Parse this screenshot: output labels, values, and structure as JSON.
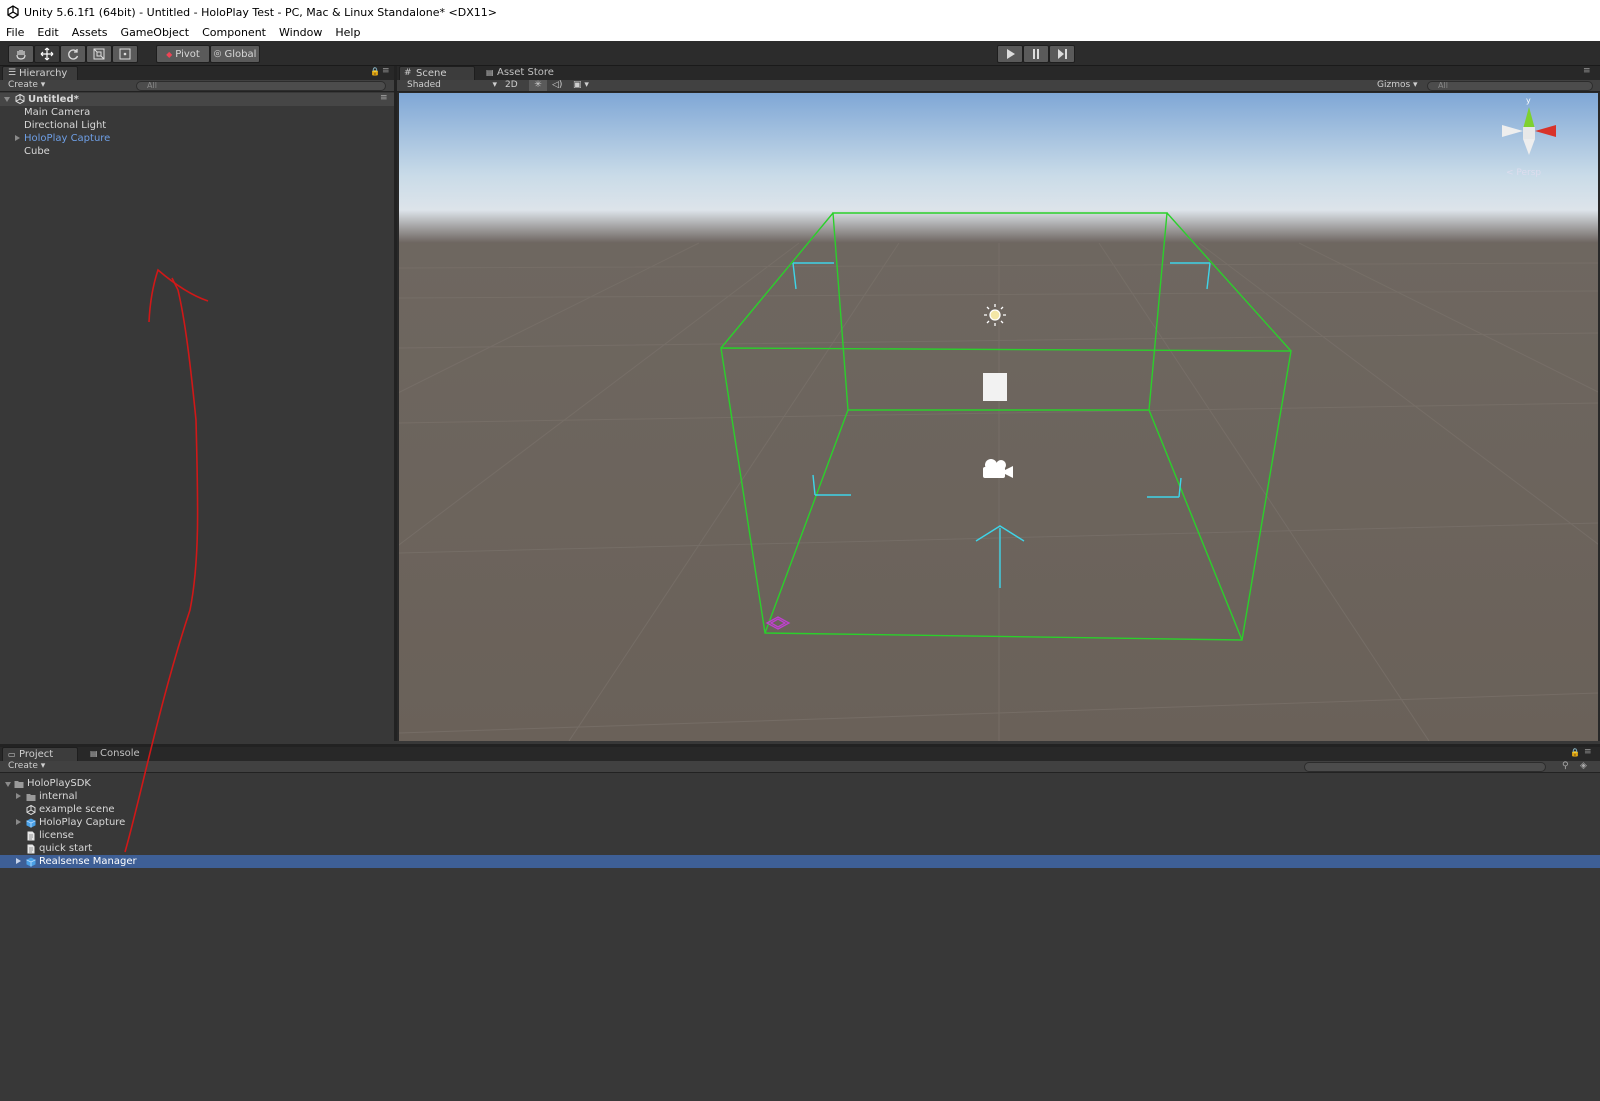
{
  "window": {
    "title": "Unity 5.6.1f1 (64bit) - Untitled - HoloPlay Test - PC, Mac & Linux Standalone* <DX11>"
  },
  "menu": [
    "File",
    "Edit",
    "Assets",
    "GameObject",
    "Component",
    "Window",
    "Help"
  ],
  "toolbar": {
    "pivot_label": "Pivot",
    "global_label": "Global"
  },
  "hierarchy": {
    "tab_label": "Hierarchy",
    "create_label": "Create",
    "search_placeholder": "All",
    "scene_name": "Untitled*",
    "items": [
      "Main Camera",
      "Directional Light",
      "HoloPlay Capture",
      "Cube"
    ]
  },
  "scene_view": {
    "tab_label": "Scene",
    "asset_store_tab": "Asset Store",
    "shading_mode": "Shaded",
    "mode_2d": "2D",
    "gizmos_label": "Gizmos",
    "search_placeholder": "All",
    "gizmo_axis_y": "y",
    "persp_label": "< Persp"
  },
  "project": {
    "tab_label": "Project",
    "console_tab": "Console",
    "create_label": "Create",
    "root": "HoloPlaySDK",
    "items": [
      "internal",
      "example scene",
      "HoloPlay Capture",
      "license",
      "quick start"
    ],
    "selected_item": "Realsense Manager"
  },
  "colors": {
    "accent_selected": "#3e5f96",
    "gizmo_box": "#2bd02b",
    "annotation": "#d01818",
    "hierarchy_prefab_text": "#6e9fe6"
  }
}
